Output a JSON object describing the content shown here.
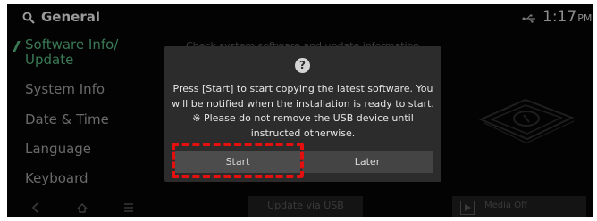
{
  "header": {
    "title": "General",
    "time": "1:17",
    "ampm": "PM"
  },
  "sidebar": {
    "items": [
      {
        "label": "Software Info/",
        "label2": "Update"
      },
      {
        "label": "System Info"
      },
      {
        "label": "Date & Time"
      },
      {
        "label": "Language"
      },
      {
        "label": "Keyboard"
      }
    ]
  },
  "background": {
    "description": "Check system software and update information."
  },
  "dialog": {
    "icon": "?",
    "message_line1": "Press [Start] to start copying the latest software. You",
    "message_line2": "will be notified when the installation is ready to start.",
    "message_line3": "※ Please do not remove the USB device until",
    "message_line4": "instructed otherwise.",
    "start_label": "Start",
    "later_label": "Later"
  },
  "bottom": {
    "update_usb_label": "Update via USB",
    "media_label": "Media Off"
  },
  "colors": {
    "highlight": "#e40f0f",
    "dialog_bg": "#2c2c2c",
    "screen_bg": "#030303"
  }
}
